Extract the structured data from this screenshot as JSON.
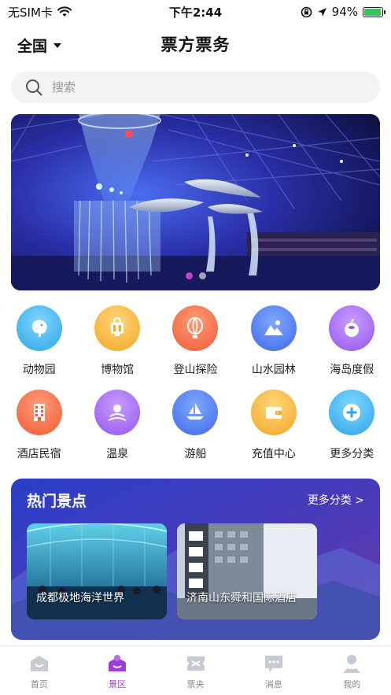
{
  "status_bar": {
    "carrier": "无SIM卡",
    "time": "下午2:44",
    "battery": "94%",
    "battery_level": 0.94
  },
  "header": {
    "region": "全国",
    "title": "票方票务"
  },
  "search": {
    "placeholder": "搜索"
  },
  "banner": {
    "slides": 2,
    "active_slide": 0
  },
  "categories": [
    {
      "label": "动物园",
      "icon": "elephant-icon",
      "color": "#3fb6ef"
    },
    {
      "label": "博物馆",
      "icon": "museum-icon",
      "color": "#f5b53a"
    },
    {
      "label": "登山探险",
      "icon": "hot-air-balloon-icon",
      "color": "#f2714a"
    },
    {
      "label": "山水园林",
      "icon": "mountain-icon",
      "color": "#4f7ef0"
    },
    {
      "label": "海岛度假",
      "icon": "coconut-icon",
      "color": "#a36af0"
    },
    {
      "label": "酒店民宿",
      "icon": "hotel-icon",
      "color": "#f2714a"
    },
    {
      "label": "温泉",
      "icon": "hot-spring-icon",
      "color": "#a36af0"
    },
    {
      "label": "游船",
      "icon": "boat-icon",
      "color": "#4f7ef0"
    },
    {
      "label": "充值中心",
      "icon": "wallet-icon",
      "color": "#f5b53a"
    },
    {
      "label": "更多分类",
      "icon": "plus-icon",
      "color": "#3fb6ef"
    }
  ],
  "hot": {
    "title": "热门景点",
    "more": "更多分类 >",
    "items": [
      {
        "name": "成都极地海洋世界"
      },
      {
        "name": "济南山东舜和国际酒店"
      }
    ]
  },
  "tabs": [
    {
      "label": "首页",
      "icon": "home-icon",
      "active": false
    },
    {
      "label": "景区",
      "icon": "scenic-icon",
      "active": true
    },
    {
      "label": "票夹",
      "icon": "ticket-icon",
      "active": false
    },
    {
      "label": "消息",
      "icon": "message-icon",
      "active": false
    },
    {
      "label": "我的",
      "icon": "profile-icon",
      "active": false
    }
  ],
  "colors": {
    "accent": "#9b3fd6",
    "tab_inactive": "#c5cad3"
  }
}
